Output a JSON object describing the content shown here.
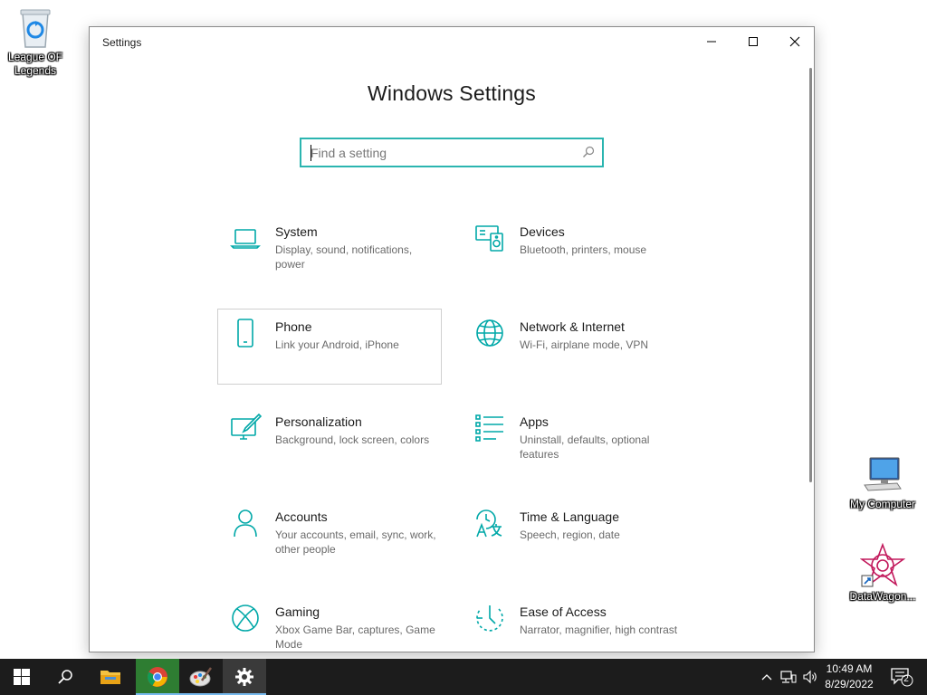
{
  "desktop": {
    "icons": [
      {
        "label": "League OF Legends"
      },
      {
        "label": "My Computer"
      },
      {
        "label": "DataWagon..."
      }
    ]
  },
  "window": {
    "title": "Settings",
    "heading": "Windows Settings",
    "search_placeholder": "Find a setting"
  },
  "tiles": [
    {
      "name": "System",
      "desc": "Display, sound, notifications, power",
      "icon": "laptop-icon"
    },
    {
      "name": "Devices",
      "desc": "Bluetooth, printers, mouse",
      "icon": "devices-icon"
    },
    {
      "name": "Phone",
      "desc": "Link your Android, iPhone",
      "icon": "phone-icon"
    },
    {
      "name": "Network & Internet",
      "desc": "Wi-Fi, airplane mode, VPN",
      "icon": "globe-icon"
    },
    {
      "name": "Personalization",
      "desc": "Background, lock screen, colors",
      "icon": "paint-icon"
    },
    {
      "name": "Apps",
      "desc": "Uninstall, defaults, optional features",
      "icon": "apps-list-icon"
    },
    {
      "name": "Accounts",
      "desc": "Your accounts, email, sync, work, other people",
      "icon": "person-icon"
    },
    {
      "name": "Time & Language",
      "desc": "Speech, region, date",
      "icon": "time-language-icon"
    },
    {
      "name": "Gaming",
      "desc": "Xbox Game Bar, captures, Game Mode",
      "icon": "xbox-icon"
    },
    {
      "name": "Ease of Access",
      "desc": "Narrator, magnifier, high contrast",
      "icon": "ease-of-access-icon"
    }
  ],
  "taskbar": {
    "time": "10:49 AM",
    "date": "8/29/2022",
    "notification_count": "2"
  },
  "colors": {
    "accent": "#00a8a8",
    "search_border": "#2bb5b0",
    "taskbar": "#1c1c1c"
  }
}
